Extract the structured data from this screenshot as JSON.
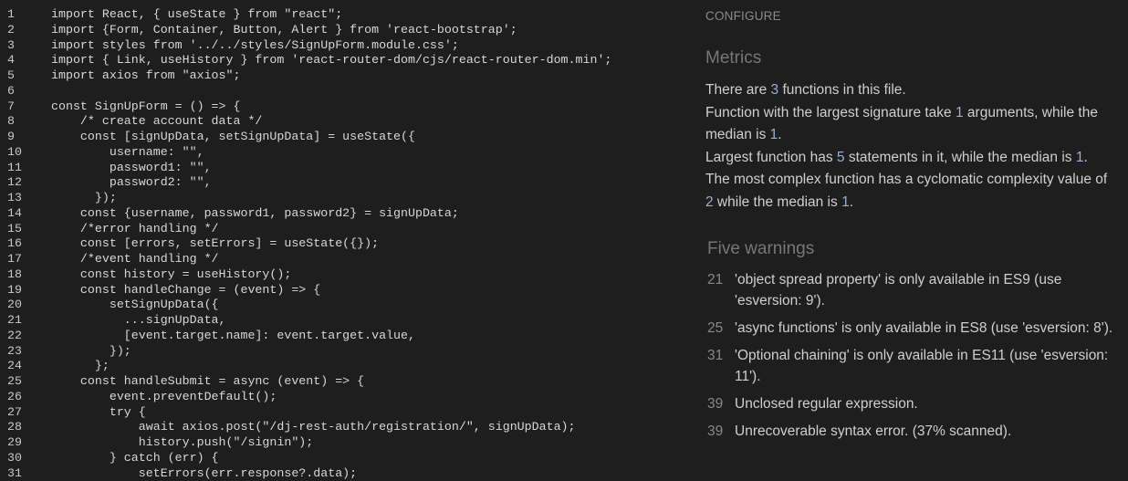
{
  "editor": {
    "lines": [
      {
        "n": "1",
        "code": "import React, { useState } from \"react\";"
      },
      {
        "n": "2",
        "code": "import {Form, Container, Button, Alert } from 'react-bootstrap';"
      },
      {
        "n": "3",
        "code": "import styles from '../../styles/SignUpForm.module.css';"
      },
      {
        "n": "4",
        "code": "import { Link, useHistory } from 'react-router-dom/cjs/react-router-dom.min';"
      },
      {
        "n": "5",
        "code": "import axios from \"axios\";"
      },
      {
        "n": "6",
        "code": ""
      },
      {
        "n": "7",
        "code": "const SignUpForm = () => {"
      },
      {
        "n": "8",
        "code": "    /* create account data */"
      },
      {
        "n": "9",
        "code": "    const [signUpData, setSignUpData] = useState({"
      },
      {
        "n": "10",
        "code": "        username: \"\","
      },
      {
        "n": "11",
        "code": "        password1: \"\","
      },
      {
        "n": "12",
        "code": "        password2: \"\","
      },
      {
        "n": "13",
        "code": "      });"
      },
      {
        "n": "14",
        "code": "    const {username, password1, password2} = signUpData;"
      },
      {
        "n": "15",
        "code": "    /*error handling */"
      },
      {
        "n": "16",
        "code": "    const [errors, setErrors] = useState({});"
      },
      {
        "n": "17",
        "code": "    /*event handling */"
      },
      {
        "n": "18",
        "code": "    const history = useHistory();"
      },
      {
        "n": "19",
        "code": "    const handleChange = (event) => {"
      },
      {
        "n": "20",
        "code": "        setSignUpData({"
      },
      {
        "n": "21",
        "code": "          ...signUpData,"
      },
      {
        "n": "22",
        "code": "          [event.target.name]: event.target.value,"
      },
      {
        "n": "23",
        "code": "        });"
      },
      {
        "n": "24",
        "code": "      };"
      },
      {
        "n": "25",
        "code": "    const handleSubmit = async (event) => {"
      },
      {
        "n": "26",
        "code": "        event.preventDefault();"
      },
      {
        "n": "27",
        "code": "        try {"
      },
      {
        "n": "28",
        "code": "            await axios.post(\"/dj-rest-auth/registration/\", signUpData);"
      },
      {
        "n": "29",
        "code": "            history.push(\"/signin\");"
      },
      {
        "n": "30",
        "code": "        } catch (err) {"
      },
      {
        "n": "31",
        "code": "            setErrors(err.response?.data);"
      }
    ]
  },
  "panel": {
    "configure": "CONFIGURE",
    "metrics_title": "Metrics",
    "metrics": {
      "m1a": "There are ",
      "m1n": "3",
      "m1b": " functions in this file.",
      "m2a": "Function with the largest signature take ",
      "m2n": "1",
      "m2b": " arguments, while the median is ",
      "m2n2": "1",
      "m2c": ".",
      "m3a": "Largest function has ",
      "m3n": "5",
      "m3b": " statements in it, while the median is ",
      "m3n2": "1",
      "m3c": ".",
      "m4a": "The most complex function has a cyclomatic complexity value of ",
      "m4n": "2",
      "m4b": " while the median is ",
      "m4n2": "1",
      "m4c": "."
    },
    "warnings_title": "Five warnings",
    "warnings": [
      {
        "line": "21",
        "text": "'object spread property' is only available in ES9 (use 'esversion: 9')."
      },
      {
        "line": "25",
        "text": "'async functions' is only available in ES8 (use 'esversion: 8')."
      },
      {
        "line": "31",
        "text": "'Optional chaining' is only available in ES11 (use 'esversion: 11')."
      },
      {
        "line": "39",
        "text": "Unclosed regular expression."
      },
      {
        "line": "39",
        "text": "Unrecoverable syntax error. (37% scanned)."
      }
    ]
  },
  "colors": {
    "background": "#1e1e1e",
    "number_highlight": "#9aaed8",
    "heading": "#777777"
  }
}
